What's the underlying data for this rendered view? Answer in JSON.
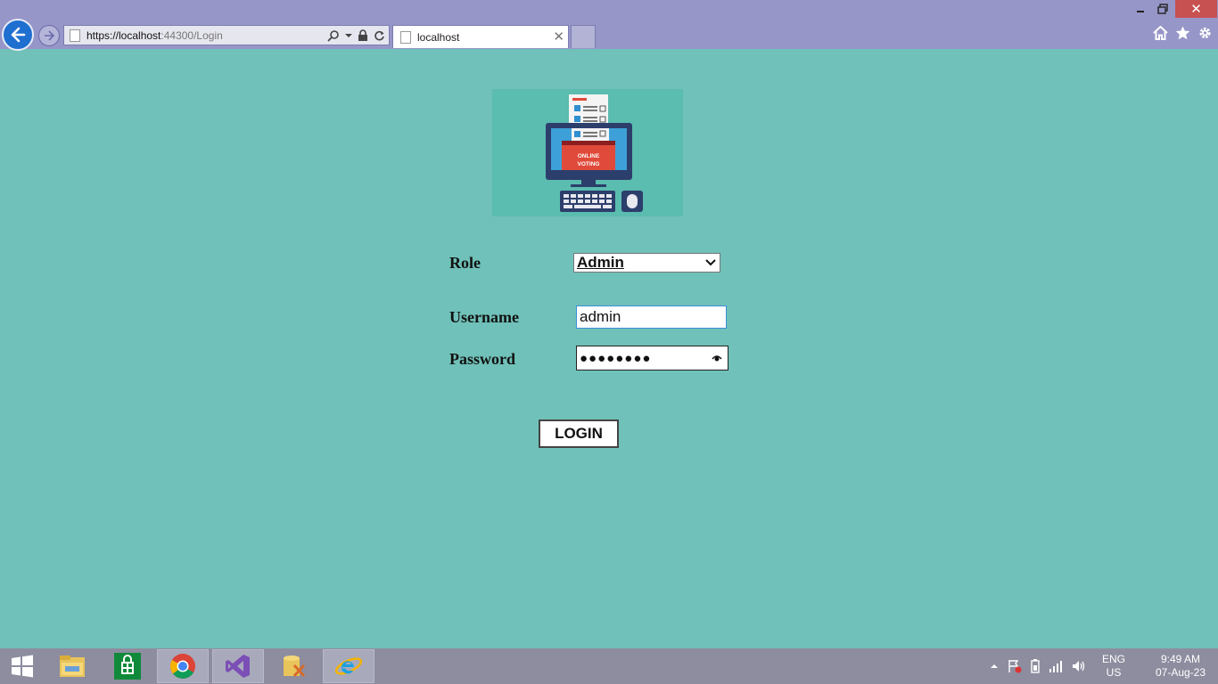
{
  "browser": {
    "url_host": "https://localhost",
    "url_rest": ":44300/Login",
    "tab_title": "localhost",
    "close_window": "✕"
  },
  "logo": {
    "line1": "ONLINE",
    "line2": "VOTING"
  },
  "form": {
    "role_label": "Role",
    "role_value": "Admin",
    "username_label": "Username",
    "username_value": "admin",
    "password_label": "Password",
    "password_masked": "●●●●●●●●",
    "login_label": "LOGIN"
  },
  "taskbar": {
    "apps": [
      "windows-start",
      "file-explorer",
      "store",
      "chrome",
      "visual-studio",
      "sql-tool",
      "internet-explorer"
    ],
    "lang_line1": "ENG",
    "lang_line2": "US",
    "time": "9:49 AM",
    "date": "07-Aug-23"
  },
  "colors": {
    "page_bg": "#70c1b9",
    "chrome_bg": "#9796c8",
    "close_red": "#c75050",
    "ballot_red": "#e04a3a",
    "monitor_navy": "#2c3e6b"
  }
}
